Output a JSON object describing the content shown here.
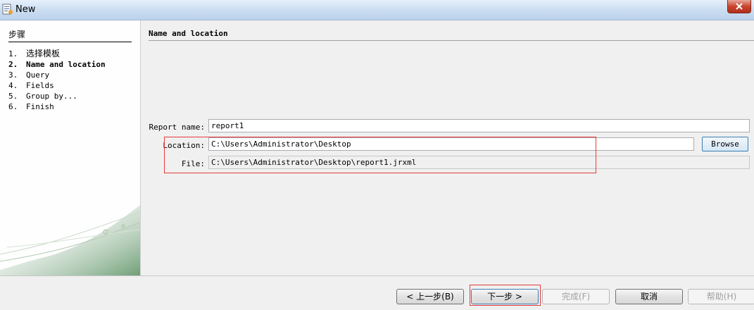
{
  "window": {
    "title": "New"
  },
  "steps": {
    "header": "步骤",
    "items": [
      {
        "num": "1.",
        "label": "选择模板"
      },
      {
        "num": "2.",
        "label": "Name and location"
      },
      {
        "num": "3.",
        "label": "Query"
      },
      {
        "num": "4.",
        "label": "Fields"
      },
      {
        "num": "5.",
        "label": "Group by..."
      },
      {
        "num": "6.",
        "label": "Finish"
      }
    ]
  },
  "content": {
    "section_title": "Name and location",
    "report_name": {
      "label": "Report name:",
      "value": "report1"
    },
    "location": {
      "label": "Location:",
      "value": "C:\\Users\\Administrator\\Desktop"
    },
    "file": {
      "label": "File:",
      "value": "C:\\Users\\Administrator\\Desktop\\report1.jrxml"
    },
    "browse_label": "Browse"
  },
  "buttons": {
    "back": "< 上一步(B)",
    "next": "下一步 >",
    "finish": "完成(F)",
    "cancel": "取消",
    "help": "帮助(H)"
  },
  "colors": {
    "highlight": "#e43a3a",
    "accent": "#3c7fb1"
  }
}
